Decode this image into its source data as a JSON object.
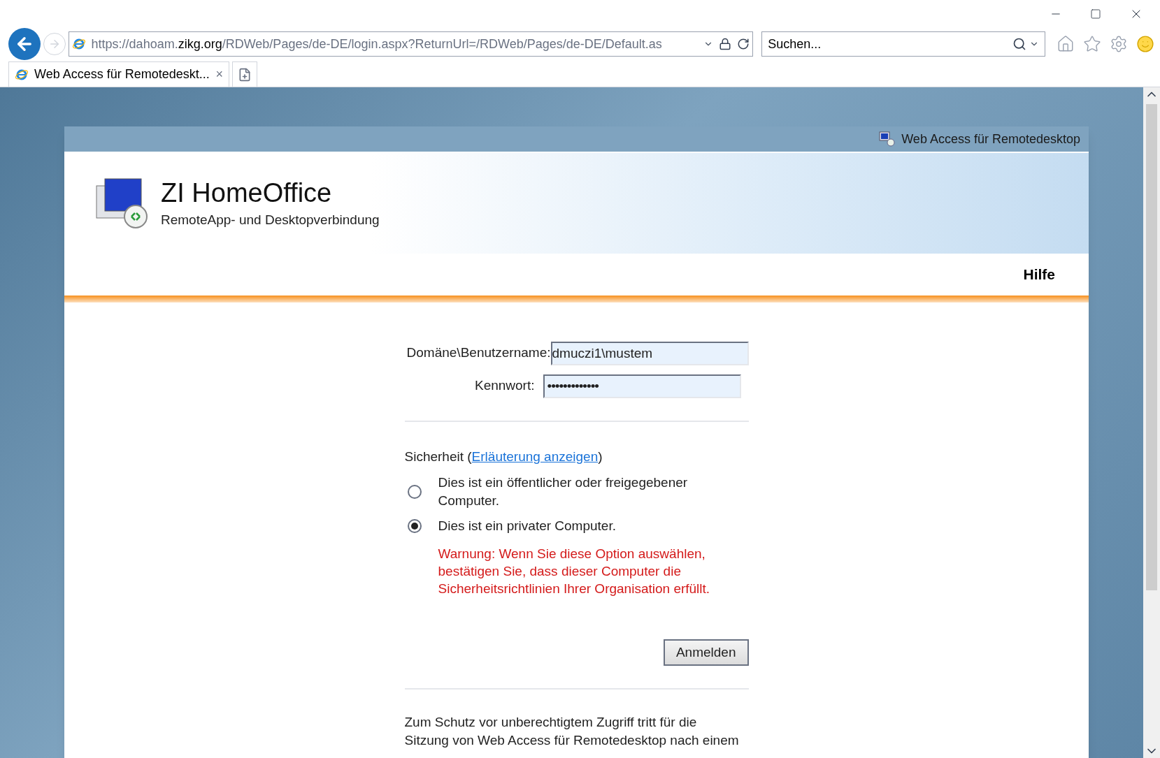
{
  "browser": {
    "address": {
      "prefix": "https://dahoam.",
      "domain": "zikg.org",
      "path": "/RDWeb/Pages/de-DE/login.aspx?ReturnUrl=/RDWeb/Pages/de-DE/Default.as"
    },
    "search": {
      "placeholder": "Suchen..."
    },
    "tabs": [
      {
        "label": "Web Access für Remotedeskt...",
        "close": "×",
        "selected": true
      }
    ]
  },
  "page": {
    "topbar_title": "Web Access für Remotedesktop",
    "title": "ZI HomeOffice",
    "subtitle": "RemoteApp- und Desktopverbindung",
    "help": "Hilfe",
    "form": {
      "username_label": "Domäne\\Benutzername:",
      "username_value": "dmuczi1\\mustem",
      "password_label": "Kennwort:",
      "password_value": "•••••••••••••",
      "security_label": "Sicherheit (",
      "security_link": "Erläuterung anzeigen",
      "security_close": ")",
      "options": [
        {
          "label": "Dies ist ein öffentlicher oder freigegebener Computer.",
          "selected": false
        },
        {
          "label": "Dies ist ein privater Computer.",
          "selected": true
        }
      ],
      "warning": "Warnung: Wenn Sie diese Option auswählen, bestätigen Sie, dass dieser Computer die Sicherheitsrichtlinien Ihrer Organisation erfüllt.",
      "submit": "Anmelden",
      "note": "Zum Schutz vor unberechtigtem Zugriff tritt für die Sitzung von Web Access für Remotedesktop nach einem"
    }
  }
}
